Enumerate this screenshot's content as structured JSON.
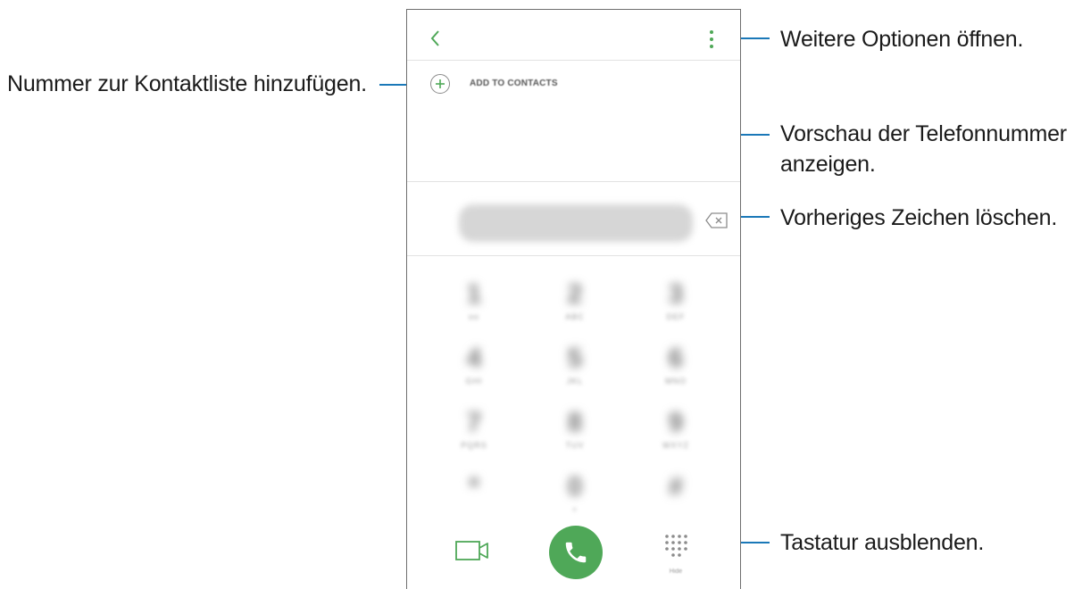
{
  "callouts": {
    "more_options": "Weitere Optionen öffnen.",
    "add_to_contacts": "Nummer zur Kontaktliste hinzufügen.",
    "preview_line1": "Vorschau der Telefonnummer",
    "preview_line2": "anzeigen.",
    "delete_char": "Vorheriges Zeichen löschen.",
    "hide_keypad": "Tastatur ausblenden."
  },
  "screen": {
    "add_to_contacts_label": "ADD TO CONTACTS",
    "number": "0000000000",
    "keys": [
      {
        "digit": "1",
        "letters": "oo"
      },
      {
        "digit": "2",
        "letters": "ABC"
      },
      {
        "digit": "3",
        "letters": "DEF"
      },
      {
        "digit": "4",
        "letters": "GHI"
      },
      {
        "digit": "5",
        "letters": "JKL"
      },
      {
        "digit": "6",
        "letters": "MNO"
      },
      {
        "digit": "7",
        "letters": "PQRS"
      },
      {
        "digit": "8",
        "letters": "TUV"
      },
      {
        "digit": "9",
        "letters": "WXYZ"
      },
      {
        "digit": "*",
        "letters": ""
      },
      {
        "digit": "0",
        "letters": "+"
      },
      {
        "digit": "#",
        "letters": ""
      }
    ],
    "hide_label": "Hide"
  },
  "colors": {
    "accent_green": "#4fa858",
    "leader_blue": "#1a78b8"
  },
  "icons": {
    "back": "back-chevron-icon",
    "more": "more-vertical-icon",
    "add": "plus-circle-icon",
    "backspace": "backspace-icon",
    "video": "video-call-icon",
    "call": "phone-icon",
    "keypad": "dialpad-icon"
  }
}
